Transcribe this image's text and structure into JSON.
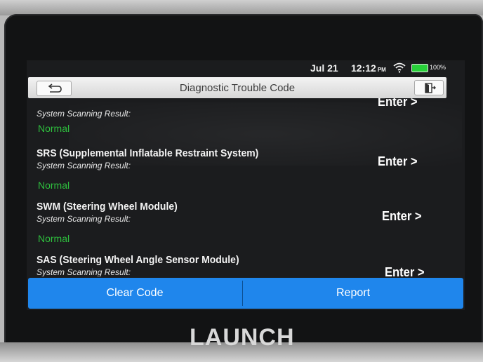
{
  "status_bar": {
    "date": "Jul 21",
    "time": "12:12",
    "ampm": "PM",
    "battery": "100%"
  },
  "header": {
    "title": "Diagnostic Trouble Code"
  },
  "systems": [
    {
      "name": "",
      "sub": "System Scanning Result:",
      "result": "Normal",
      "enter": "Enter >"
    },
    {
      "name": "SRS (Supplemental Inflatable Restraint System)",
      "sub": "System Scanning Result:",
      "result": "Normal",
      "enter": "Enter >"
    },
    {
      "name": "SWM (Steering Wheel Module)",
      "sub": "System Scanning Result:",
      "result": "Normal",
      "enter": "Enter >"
    },
    {
      "name": "SAS (Steering Wheel Angle Sensor Module)",
      "sub": "System Scanning Result:",
      "result": "",
      "enter": "Enter >"
    }
  ],
  "actions": {
    "clear_code": "Clear Code",
    "report": "Report"
  },
  "device": {
    "brand": "LAUNCH"
  },
  "colors": {
    "accent_blue": "#1f86ec",
    "normal_green": "#2ebf3e",
    "battery_green": "#28d13a"
  },
  "icons": [
    "back-arrow-icon",
    "exit-icon",
    "wifi-icon",
    "battery-icon"
  ]
}
